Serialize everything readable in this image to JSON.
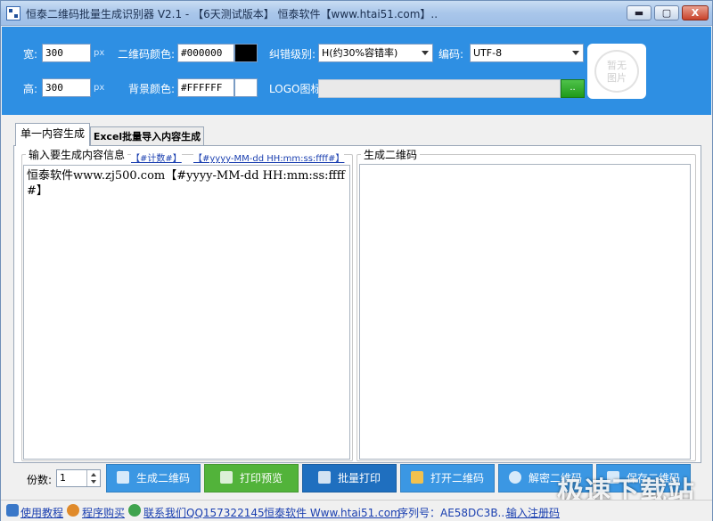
{
  "window": {
    "title": "恒泰二维码批量生成识别器 V2.1  - 【6天测试版本】 恒泰软件【www.htai51.com】..",
    "min_label": "▬",
    "max_label": "▢",
    "close_label": "X"
  },
  "settings": {
    "width_label": "宽:",
    "width_value": "300",
    "height_label": "高:",
    "height_value": "300",
    "unit": "px",
    "qr_color_label": "二维码颜色:",
    "qr_color_value": "#000000",
    "qr_color_swatch": "#000000",
    "bg_color_label": "背景颜色:",
    "bg_color_value": "#FFFFFF",
    "bg_color_swatch": "#FFFFFF",
    "ecc_label": "纠错级别:",
    "ecc_value": "H(约30%容错率)",
    "encoding_label": "编码:",
    "encoding_value": "UTF-8",
    "logo_label": "LOGO图标:",
    "logo_button": "..",
    "preview_placeholder_line1": "暂无",
    "preview_placeholder_line2": "图片"
  },
  "tabs": [
    {
      "label": "单一内容生成",
      "active": true
    },
    {
      "label": "Excel批量导入内容生成",
      "active": false
    }
  ],
  "input_group": {
    "legend": "输入要生成内容信息",
    "token_counter": "【#计数#】",
    "token_datetime": "【#yyyy-MM-dd HH:mm:ss:ffff#】",
    "content": "恒泰软件www.zj500.com【#yyyy-MM-dd HH:mm:ss:ffff#】"
  },
  "output_group": {
    "legend": "生成二维码"
  },
  "actions": {
    "copies_label": "份数:",
    "copies_value": "1",
    "buttons": [
      {
        "label": "生成二维码",
        "color": "#3b97e3"
      },
      {
        "label": "打印预览",
        "color": "#52b33a"
      },
      {
        "label": "批量打印",
        "color": "#1f6fbf"
      },
      {
        "label": "打开二维码",
        "color": "#3b97e3"
      },
      {
        "label": "解密二维码",
        "color": "#3b97e3"
      },
      {
        "label": "保存二维码",
        "color": "#3b97e3"
      }
    ]
  },
  "statusbar": {
    "tutorial": "使用教程",
    "purchase": "程序购买",
    "contact": "联系我们QQ157322145",
    "website": "恒泰软件 Www.htai51.com",
    "serial": "序列号：AE58DC3B...",
    "register": "输入注册码"
  },
  "watermark": "极速下载站"
}
